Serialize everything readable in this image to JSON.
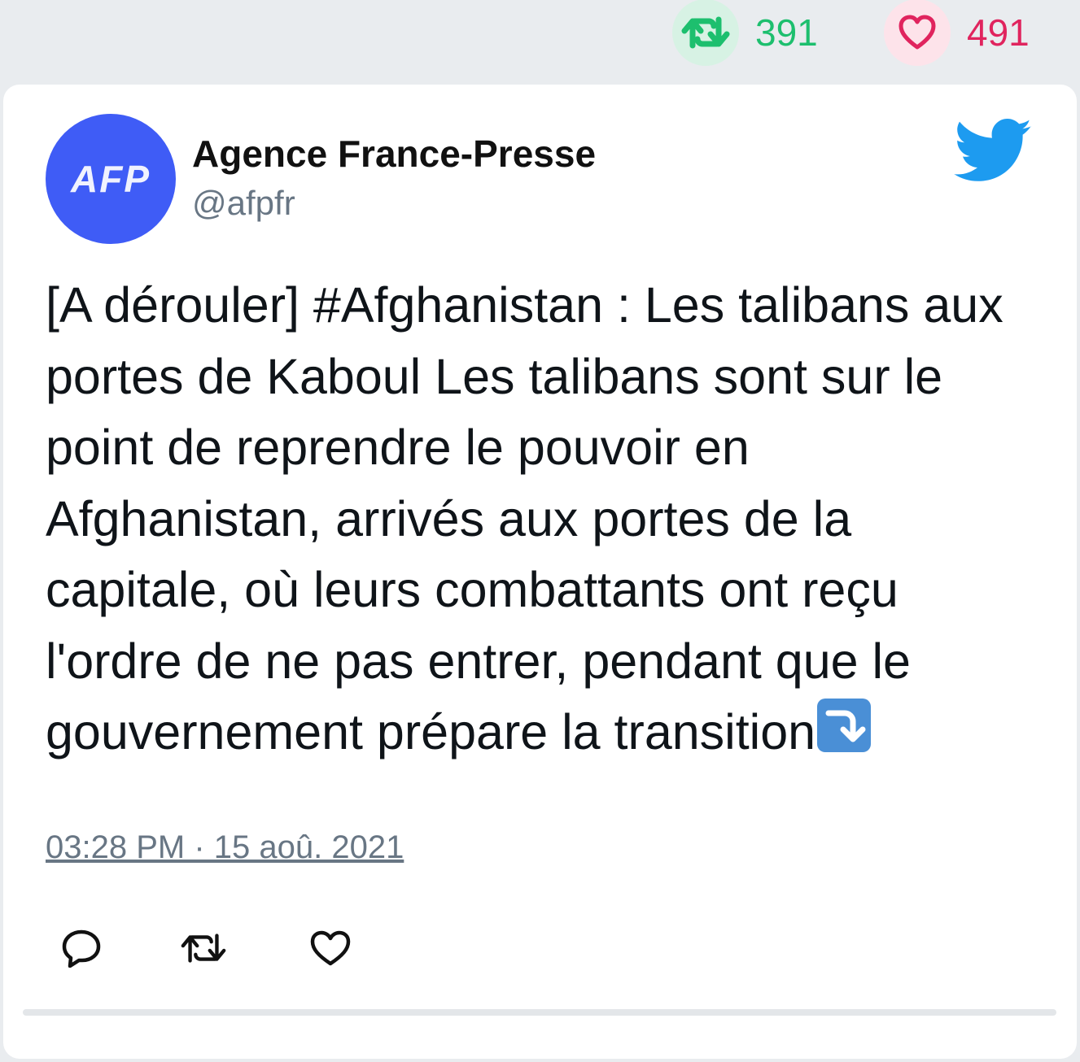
{
  "top_stats": {
    "retweet_count": "391",
    "like_count": "491",
    "retweet_icon": "retweet-icon",
    "like_icon": "heart-icon",
    "colors": {
      "retweet": "#1dbf6e",
      "like": "#e0245e"
    }
  },
  "tweet": {
    "avatar_text": "AFP",
    "author_name": "Agence France-Presse",
    "author_handle": "@afpfr",
    "text": "[A dérouler] #Afghanistan : Les talibans aux portes de Kaboul Les talibans sont sur le point de reprendre le pouvoir en Afghanistan, arrivés aux portes de la capitale, où leurs combattants ont reçu l'ordre de ne pas entrer, pendant que le gouvernement prépare la transition",
    "text_emoji": "arrow-down-right-emoji",
    "timestamp": "03:28 PM · 15 aoû. 2021",
    "logo": "twitter-bird-icon",
    "avatar_color": "#3f5cf6",
    "brand_color": "#1d9bf0"
  },
  "actions": {
    "reply_icon": "reply-icon",
    "retweet_icon": "retweet-icon",
    "like_icon": "heart-icon"
  }
}
